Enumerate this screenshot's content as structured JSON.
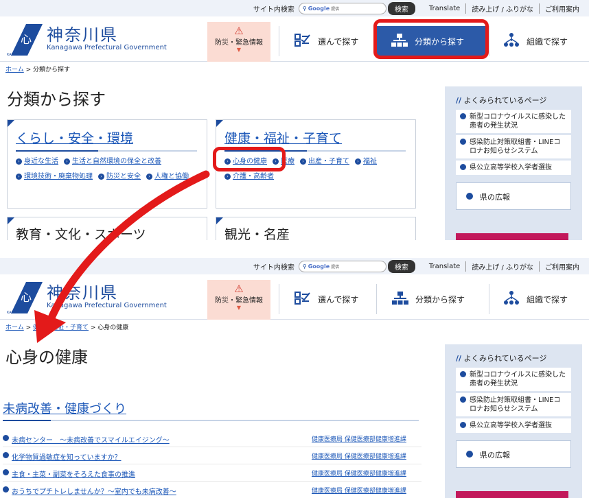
{
  "topbar": {
    "site_search": "サイト内検索",
    "google_label": "Google",
    "google_sub": "提供",
    "search_button": "検索",
    "translate": "Translate",
    "read_aloud": "読み上げ / ふりがな",
    "guide": "ご利用案内"
  },
  "header": {
    "title": "神奈川県",
    "subtitle": "Kanagawa Prefectural Government",
    "emblem_text": "KANAGAWA",
    "emergency": "防災・緊急情報",
    "nav_select": "選んで探す",
    "nav_category": "分類から探す",
    "nav_org": "組織で探す"
  },
  "page1": {
    "breadcrumb_home": "ホーム",
    "breadcrumb_current": "分類から探す",
    "title": "分類から探す",
    "card1": {
      "title": "くらし・安全・環境",
      "links": [
        "身近な生活",
        "生活と自然環境の保全と改善",
        "環境技術・廃棄物処理",
        "防災と安全",
        "人権と協働"
      ]
    },
    "card2": {
      "title": "健康・福祉・子育て",
      "links": [
        "心身の健康",
        "医療",
        "出産・子育て",
        "福祉",
        "介護・高齢者"
      ]
    },
    "card3_title": "教育・文化・スポーツ",
    "card4_title": "観光・名産"
  },
  "sidebar": {
    "heading": "よくみられているページ",
    "items": [
      "新型コロナウイルスに感染した患者の発生状況",
      "感染防止対策取組書・LINEコロナお知らせシステム",
      "県公立高等学校入学者選抜"
    ],
    "koho": "県の広報"
  },
  "page2": {
    "breadcrumb_home": "ホーム",
    "breadcrumb_mid": "健康・福祉・子育て",
    "breadcrumb_current": "心身の健康",
    "title": "心身の健康",
    "section_title": "未病改善・健康づくり",
    "rows": [
      {
        "text": "未病センター　～未病改善でスマイルエイジング～",
        "dept": "健康医療局 保健医療部健康増進課"
      },
      {
        "text": "化学物質過敏症を知っていますか？",
        "dept": "健康医療局 保健医療部健康増進課"
      },
      {
        "text": "主食・主菜・副菜をそろえた食事の推進",
        "dept": "健康医療局 保健医療部健康増進課"
      },
      {
        "text": "おうちでプチトレしませんか？～室内でも未病改善～",
        "dept": "健康医療局 保健医療部健康増進課"
      }
    ]
  },
  "colors": {
    "brand": "#1d4c9e",
    "highlight": "#e31a1a",
    "emergency_bg": "#fbdcd3",
    "sidebar_bg": "#dde5f1"
  }
}
